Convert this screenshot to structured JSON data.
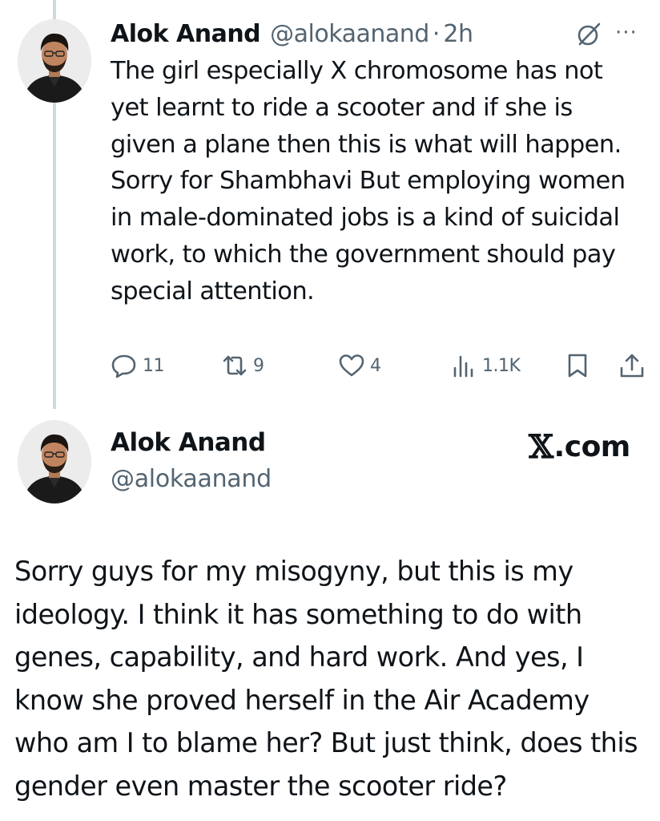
{
  "post1": {
    "display_name": "Alok Anand",
    "handle": "@alokaanand",
    "separator": "·",
    "time": "2h",
    "more_label": "···",
    "text": "The girl especially X chromosome has not yet learnt to ride a scooter and if she is given a plane then this is what will happen. Sorry for Shambhavi But employing women in male-dominated jobs is a kind of suicidal work, to which the government should pay special attention.",
    "actions": {
      "replies": "11",
      "reposts": "9",
      "likes": "4",
      "views": "1.1K"
    }
  },
  "post2": {
    "display_name": "Alok Anand",
    "handle": "@alokaanand",
    "brand_mark": "𝕏",
    "brand_text": ".com",
    "text": "Sorry guys for my misogyny, but this is my ideology. I think it has something to do with genes, capability, and hard work. And yes, I know she proved herself in the Air Academy who am I to blame her? But just think, does this gender even master the scooter ride?"
  },
  "icons": {
    "reply": "reply-icon",
    "repost": "repost-icon",
    "like": "heart-icon",
    "views": "views-icon",
    "bookmark": "bookmark-icon",
    "share": "share-icon",
    "grok": "grok-icon",
    "more": "more-icon"
  },
  "colors": {
    "text": "#0f1419",
    "secondary": "#536471",
    "thread_line": "#cfd9de"
  }
}
